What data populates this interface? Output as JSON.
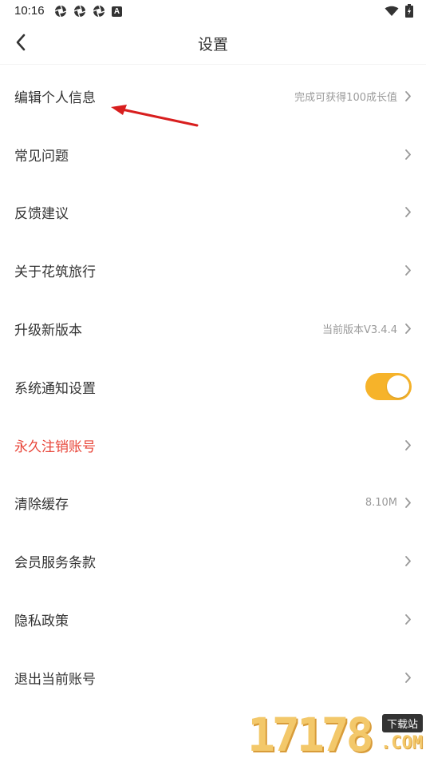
{
  "status_bar": {
    "time": "10:16",
    "left_icons": [
      "aperture-icon",
      "aperture-icon",
      "aperture-icon",
      "font-badge-icon"
    ],
    "font_badge_text": "A",
    "right_icons": [
      "wifi-icon",
      "battery-charging-icon"
    ]
  },
  "header": {
    "title": "设置",
    "back_icon": "chevron-left-icon"
  },
  "settings": {
    "edit_profile": {
      "label": "编辑个人信息",
      "value": "完成可获得100成长值"
    },
    "faq": {
      "label": "常见问题"
    },
    "feedback": {
      "label": "反馈建议"
    },
    "about": {
      "label": "关于花筑旅行"
    },
    "upgrade": {
      "label": "升级新版本",
      "value": "当前版本V3.4.4"
    },
    "notifications": {
      "label": "系统通知设置",
      "toggle_on": true
    },
    "delete_account": {
      "label": "永久注销账号"
    },
    "clear_cache": {
      "label": "清除缓存",
      "value": "8.10M"
    },
    "member_terms": {
      "label": "会员服务条款"
    },
    "privacy": {
      "label": "隐私政策"
    },
    "logout": {
      "label": "退出当前账号"
    }
  },
  "colors": {
    "accent_toggle": "#f6b32a",
    "danger_text": "#e8463a",
    "annotation_arrow": "#d81e1e",
    "watermark": "#f3c86a"
  },
  "watermark": {
    "digits": "17178",
    "badge": "下载站",
    "domain": ".COM"
  }
}
